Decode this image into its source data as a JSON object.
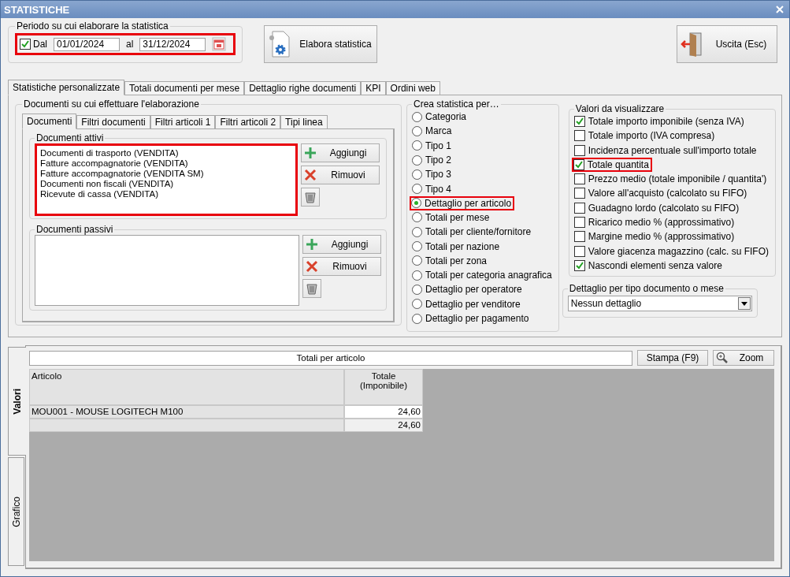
{
  "window": {
    "title": "STATISTICHE"
  },
  "period": {
    "legend": "Periodo su cui elaborare la statistica",
    "highlighted": true,
    "checkbox": {
      "label": "Dal",
      "checked": true
    },
    "from": "01/01/2024",
    "to_label": "al",
    "to": "31/12/2024"
  },
  "actions": [
    {
      "label": "Elabora statistica",
      "kind": "process"
    },
    {
      "label": "Uscita (Esc)",
      "kind": "exit"
    }
  ],
  "tabs": [
    {
      "label": "Statistiche personalizzate",
      "selected": true
    },
    {
      "label": "Totali documenti per mese",
      "selected": false
    },
    {
      "label": "Dettaglio righe documenti",
      "selected": false
    },
    {
      "label": "KPI",
      "selected": false
    },
    {
      "label": "Ordini web",
      "selected": false
    }
  ],
  "documents": {
    "legend": "Documenti su cui effettuare l'elaborazione",
    "tabs": [
      {
        "label": "Documenti",
        "selected": true
      },
      {
        "label": "Filtri documenti",
        "selected": false
      },
      {
        "label": "Filtri articoli 1",
        "selected": false
      },
      {
        "label": "Filtri articoli 2",
        "selected": false
      },
      {
        "label": "Tipi linea",
        "selected": false
      }
    ],
    "lists": [
      {
        "legend": "Documenti attivi",
        "highlighted": true,
        "items": [
          "Documenti di trasporto (VENDITA)",
          "Fatture accompagnatorie (VENDITA)",
          "Fatture accompagnatorie (VENDITA SM)",
          "Documenti non fiscali (VENDITA)",
          "Ricevute di cassa (VENDITA)"
        ],
        "buttons": [
          {
            "label": "Aggiungi",
            "kind": "add"
          },
          {
            "label": "Rimuovi",
            "kind": "remove"
          },
          {
            "kind": "delete"
          }
        ]
      },
      {
        "legend": "Documenti passivi",
        "highlighted": false,
        "buttons": [
          {
            "label": "Aggiungi",
            "kind": "add"
          },
          {
            "label": "Rimuovi",
            "kind": "remove"
          },
          {
            "kind": "delete"
          }
        ]
      }
    ]
  },
  "group_by": {
    "legend": "Crea statistica per…",
    "options": [
      {
        "label": "Categoria",
        "selected": false,
        "highlighted": false
      },
      {
        "label": "Marca",
        "selected": false,
        "highlighted": false
      },
      {
        "label": "Tipo 1",
        "selected": false,
        "highlighted": false
      },
      {
        "label": "Tipo 2",
        "selected": false,
        "highlighted": false
      },
      {
        "label": "Tipo 3",
        "selected": false,
        "highlighted": false
      },
      {
        "label": "Tipo 4",
        "selected": false,
        "highlighted": false
      },
      {
        "label": "Dettaglio per articolo",
        "selected": true,
        "highlighted": true
      },
      {
        "label": "Totali per mese",
        "selected": false,
        "highlighted": false
      },
      {
        "label": "Totali per cliente/fornitore",
        "selected": false,
        "highlighted": false
      },
      {
        "label": "Totali per nazione",
        "selected": false,
        "highlighted": false
      },
      {
        "label": "Totali per zona",
        "selected": false,
        "highlighted": false
      },
      {
        "label": "Totali per categoria anagrafica",
        "selected": false,
        "highlighted": false
      },
      {
        "label": "Dettaglio per operatore",
        "selected": false,
        "highlighted": false
      },
      {
        "label": "Dettaglio per venditore",
        "selected": false,
        "highlighted": false
      },
      {
        "label": "Dettaglio per pagamento",
        "selected": false,
        "highlighted": false
      }
    ]
  },
  "values": {
    "legend": "Valori da visualizzare",
    "options": [
      {
        "label": "Totale importo imponibile (senza IVA)",
        "checked": true,
        "highlighted": false
      },
      {
        "label": "Totale importo (IVA compresa)",
        "checked": false,
        "highlighted": false
      },
      {
        "label": "Incidenza percentuale sull'importo totale",
        "checked": false,
        "highlighted": false
      },
      {
        "label": "Totale quantita",
        "checked": true,
        "highlighted": true
      },
      {
        "label": "Prezzo medio (totale imponibile / quantita')",
        "checked": false,
        "highlighted": false
      },
      {
        "label": "Valore all'acquisto (calcolato su FIFO)",
        "checked": false,
        "highlighted": false
      },
      {
        "label": "Guadagno lordo (calcolato su FIFO)",
        "checked": false,
        "highlighted": false
      },
      {
        "label": "Ricarico medio % (approssimativo)",
        "checked": false,
        "highlighted": false
      },
      {
        "label": "Margine medio % (approssimativo)",
        "checked": false,
        "highlighted": false
      },
      {
        "label": "Valore giacenza magazzino (calc. su FIFO)",
        "checked": false,
        "highlighted": false
      },
      {
        "label": "Nascondi elementi senza valore",
        "checked": true,
        "highlighted": false
      }
    ]
  },
  "detail": {
    "legend": "Dettaglio per tipo documento o mese",
    "value": "Nessun dettaglio"
  },
  "results": {
    "side_tabs": [
      {
        "label": "Valori",
        "selected": true
      },
      {
        "label": "Grafico",
        "selected": false
      }
    ],
    "title": "Totali per articolo",
    "buttons": [
      {
        "label": "Stampa (F9)",
        "kind": "print"
      },
      {
        "label": "Zoom",
        "kind": "zoom"
      }
    ],
    "table": {
      "columns": [
        "Articolo",
        "Totale (Imponibile)"
      ],
      "rows": [
        {
          "cells": [
            "MOU001 - MOUSE LOGITECH M100",
            "24,60"
          ]
        }
      ],
      "total": "24,60"
    }
  }
}
